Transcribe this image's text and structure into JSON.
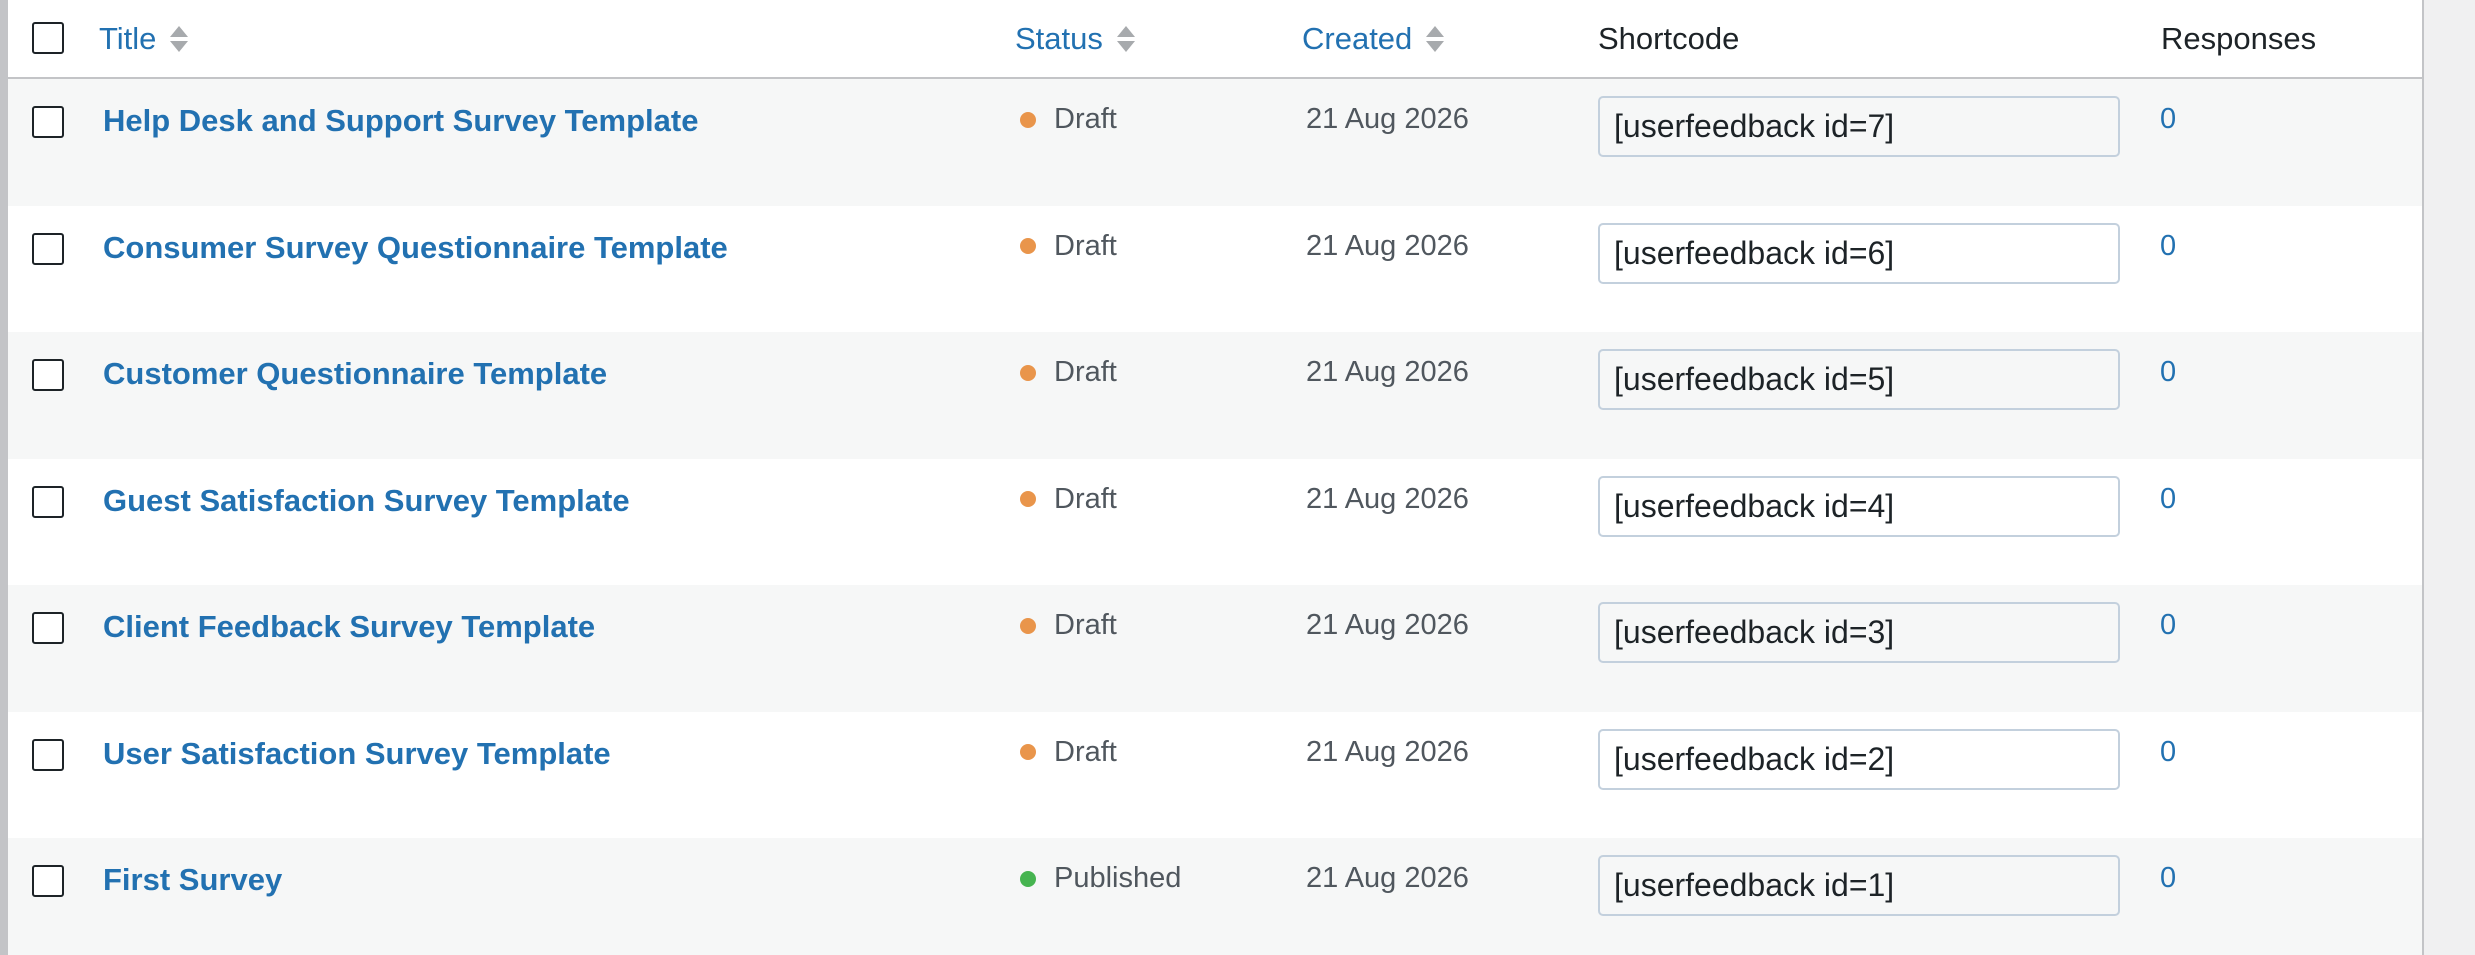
{
  "table": {
    "columns": {
      "title": "Title",
      "status": "Status",
      "created": "Created",
      "shortcode": "Shortcode",
      "responses": "Responses"
    },
    "status_colors": {
      "Draft": "#e9954b",
      "Published": "#46b450"
    },
    "rows": [
      {
        "title": "Help Desk and Support Survey Template",
        "status": "Draft",
        "created": "21 Aug 2026",
        "shortcode": "[userfeedback id=7]",
        "responses": "0"
      },
      {
        "title": "Consumer Survey Questionnaire Template",
        "status": "Draft",
        "created": "21 Aug 2026",
        "shortcode": "[userfeedback id=6]",
        "responses": "0"
      },
      {
        "title": "Customer Questionnaire Template",
        "status": "Draft",
        "created": "21 Aug 2026",
        "shortcode": "[userfeedback id=5]",
        "responses": "0"
      },
      {
        "title": "Guest Satisfaction Survey Template",
        "status": "Draft",
        "created": "21 Aug 2026",
        "shortcode": "[userfeedback id=4]",
        "responses": "0"
      },
      {
        "title": "Client Feedback Survey Template",
        "status": "Draft",
        "created": "21 Aug 2026",
        "shortcode": "[userfeedback id=3]",
        "responses": "0"
      },
      {
        "title": "User Satisfaction Survey Template",
        "status": "Draft",
        "created": "21 Aug 2026",
        "shortcode": "[userfeedback id=2]",
        "responses": "0"
      },
      {
        "title": "First Survey",
        "status": "Published",
        "created": "21 Aug 2026",
        "shortcode": "[userfeedback id=1]",
        "responses": "0"
      }
    ]
  }
}
